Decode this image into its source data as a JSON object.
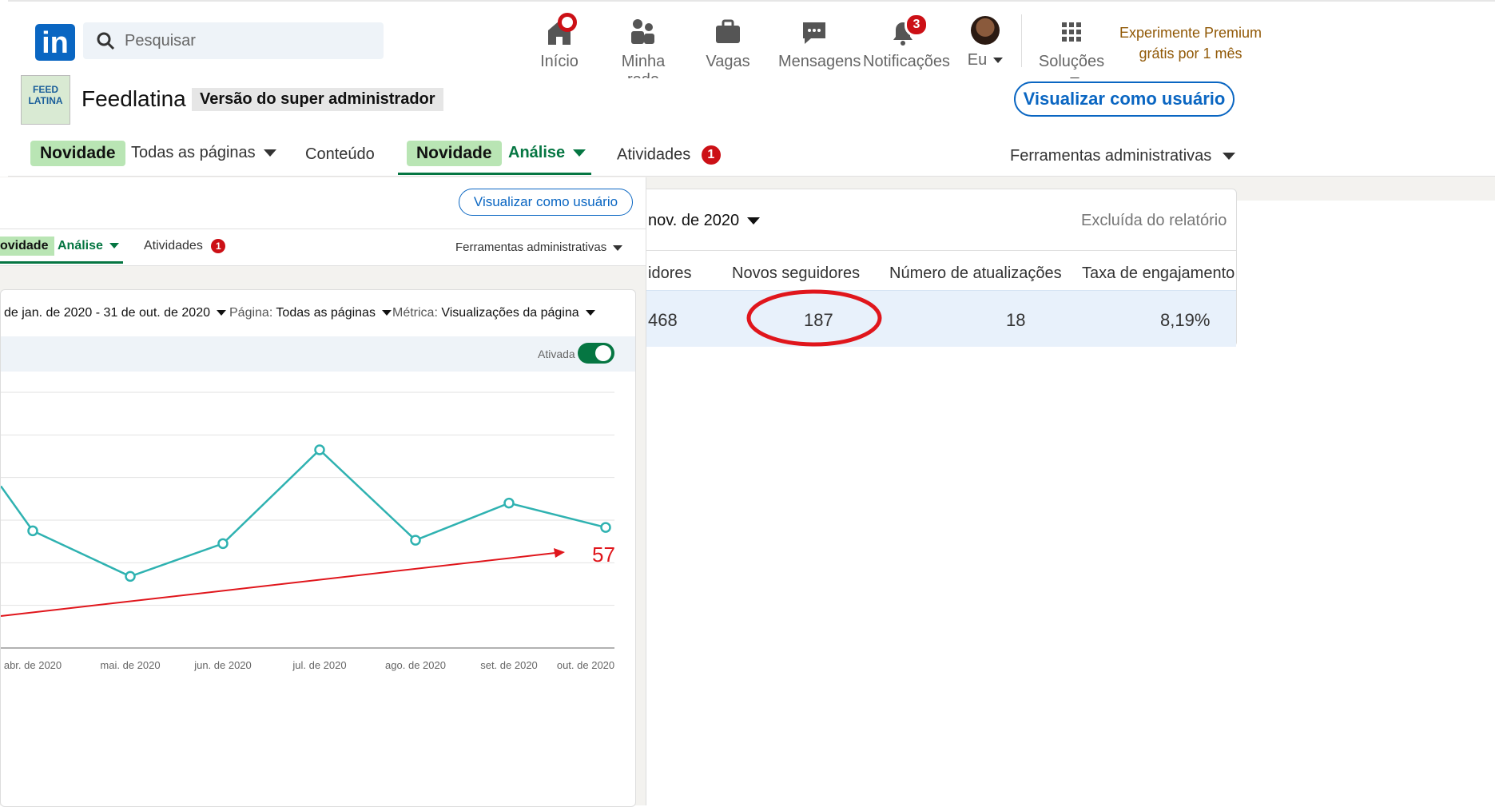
{
  "topnav": {
    "search_placeholder": "Pesquisar",
    "items": [
      {
        "label": "Início",
        "icon": "home-icon"
      },
      {
        "label": "Minha rede",
        "icon": "network-icon"
      },
      {
        "label": "Vagas",
        "icon": "briefcase-icon"
      },
      {
        "label": "Mensagens",
        "icon": "messaging-icon"
      },
      {
        "label": "Notificações",
        "icon": "bell-icon",
        "badge": "3"
      },
      {
        "label": "Eu",
        "icon": "avatar"
      },
      {
        "label": "Soluções",
        "icon": "grid-icon"
      }
    ],
    "premium_line1": "Experimente Premium",
    "premium_line2": "grátis por 1 mês"
  },
  "page": {
    "name": "Feedlatina",
    "admin_badge": "Versão do super administrador",
    "view_as_user": "Visualizar como usuário"
  },
  "tabs": {
    "new_label": "Novidade",
    "all_pages": "Todas as páginas",
    "content": "Conteúdo",
    "analysis": "Análise",
    "activities": "Atividades",
    "activities_badge": "1",
    "admin_tools": "Ferramentas administrativas"
  },
  "table": {
    "date_fragment": "nov. de 2020",
    "excluded": "Excluída do relatório",
    "headers": [
      "idores",
      "Novos seguidores",
      "Número de atualizações",
      "Taxa de engajamento"
    ],
    "row": [
      "468",
      "187",
      "18",
      "8,19%"
    ]
  },
  "inset": {
    "view_as_user": "Visualizar como usuário",
    "tab_new_fragment": "ovidade",
    "tab_analysis": "Análise",
    "tab_activities": "Atividades",
    "tab_activities_badge": "1",
    "admin_tools": "Ferramentas administrativas",
    "filter_date": "de jan. de 2020 - 31 de out. de 2020",
    "filter_page_label": "Página:",
    "filter_page_value": "Todas as páginas",
    "filter_metric_label": "Métrica:",
    "filter_metric_value": "Visualizações da página",
    "toggle_label": "Ativada",
    "annotation_value": "57"
  },
  "chart_data": {
    "type": "line",
    "categories": [
      "abr. de 2020",
      "mai. de 2020",
      "jun. de 2020",
      "jul. de 2020",
      "ago. de 2020",
      "set. de 2020",
      "out. de 2020"
    ],
    "series": [
      {
        "values": [
          27.5,
          16.8,
          24.5,
          46.5,
          25.3,
          34.0,
          28.3
        ]
      }
    ],
    "leading_fragment_value": 38,
    "ylim": [
      0,
      60
    ],
    "grid": true,
    "color": "#2fb2b1"
  },
  "colors": {
    "linkedin_blue": "#0a66c2",
    "highlight_red": "#e0161c",
    "premium_gold": "#915907",
    "green": "#057642",
    "row_highlight": "#e8f1fb"
  }
}
